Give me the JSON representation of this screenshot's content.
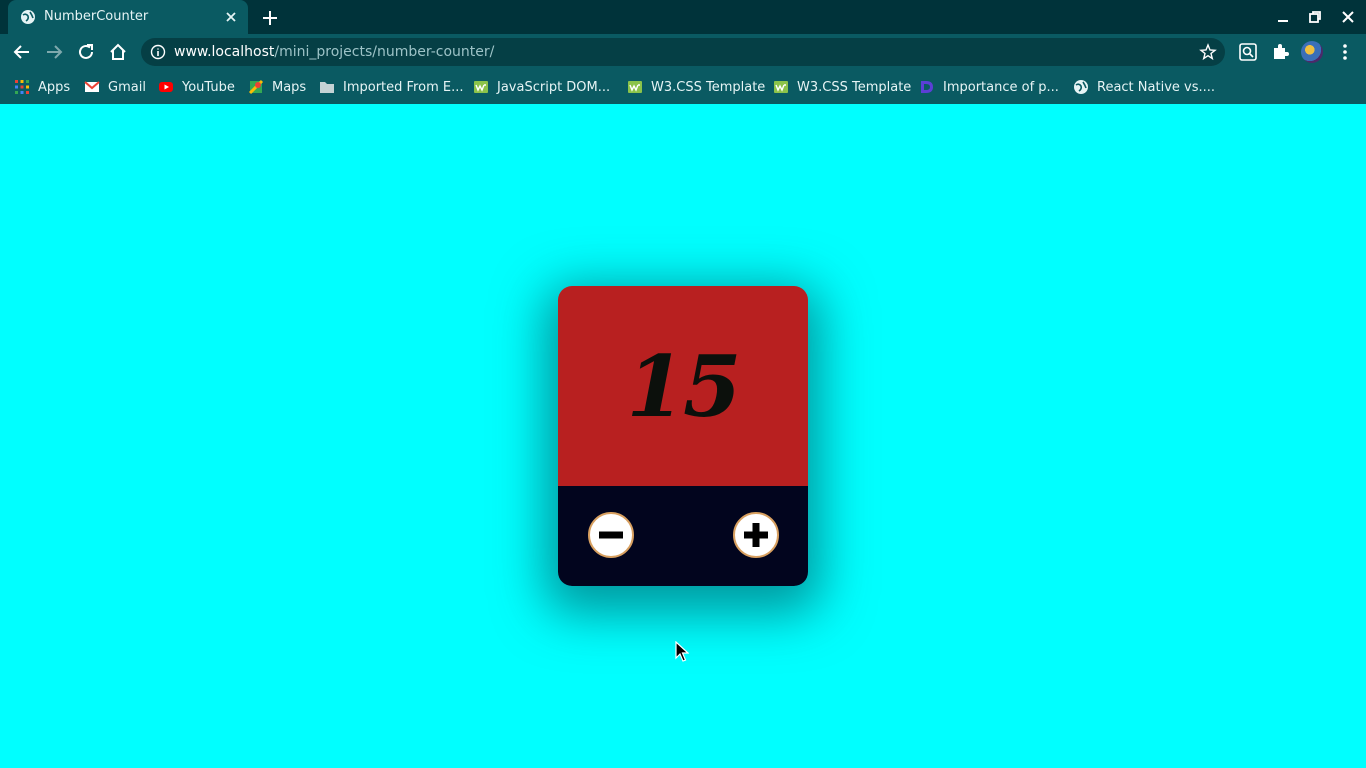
{
  "browser": {
    "tab": {
      "title": "NumberCounter"
    },
    "address": {
      "host": "www.localhost",
      "path": "/mini_projects/number-counter/"
    },
    "bookmarks": [
      {
        "label": "Apps",
        "icon": "apps-grid-icon"
      },
      {
        "label": "Gmail",
        "icon": "gmail-icon"
      },
      {
        "label": "YouTube",
        "icon": "youtube-icon"
      },
      {
        "label": "Maps",
        "icon": "maps-icon"
      },
      {
        "label": "Imported From E...",
        "icon": "folder-icon"
      },
      {
        "label": "JavaScript DOM...",
        "icon": "w3-icon"
      },
      {
        "label": "W3.CSS Template",
        "icon": "w3-icon"
      },
      {
        "label": "W3.CSS Template",
        "icon": "w3-icon"
      },
      {
        "label": "Importance of p...",
        "icon": "dev-icon"
      },
      {
        "label": "React Native vs....",
        "icon": "globe-icon"
      }
    ]
  },
  "counter": {
    "value": "15",
    "decrement_icon": "minus-circle-icon",
    "increment_icon": "plus-circle-icon"
  },
  "colors": {
    "page_background": "#00ffff",
    "display_background": "#b82020",
    "controls_background": "#02051e",
    "number_color": "#0c100c"
  }
}
